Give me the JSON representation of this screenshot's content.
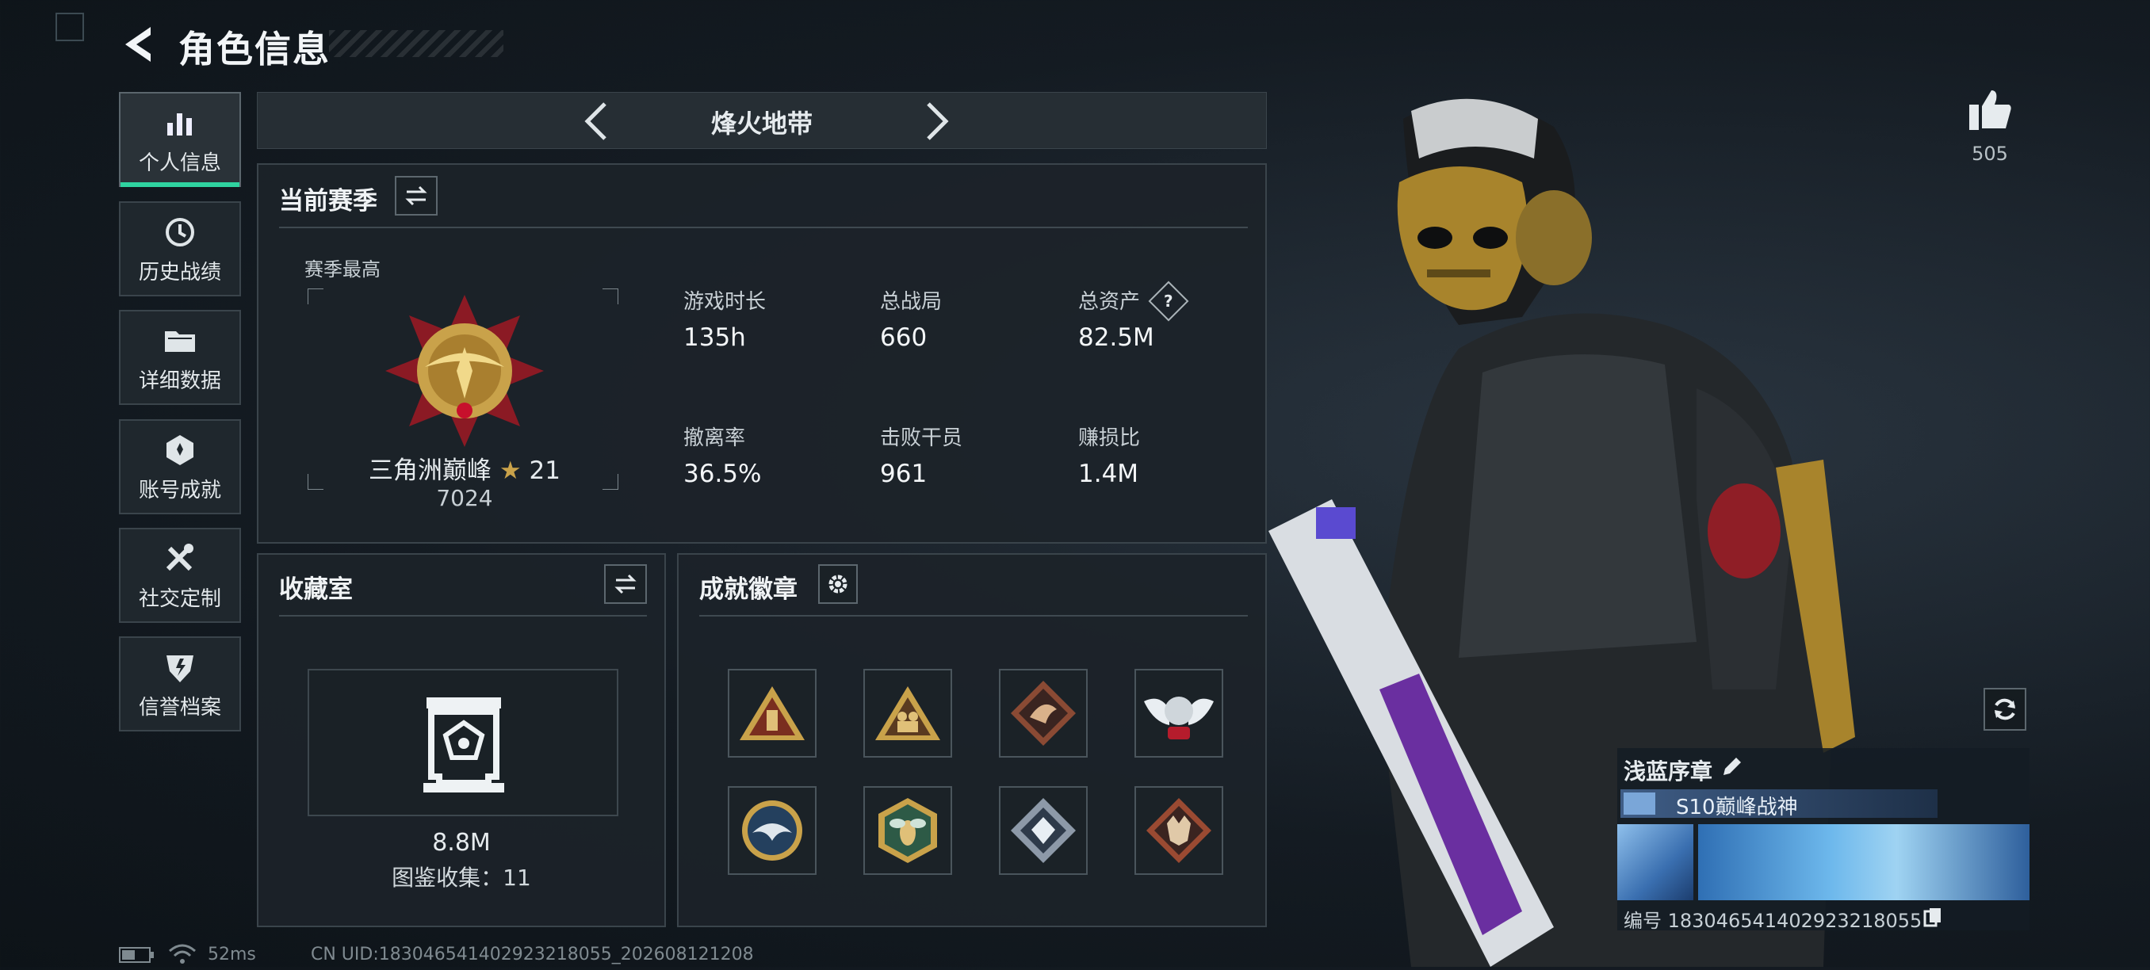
{
  "header": {
    "title": "角色信息"
  },
  "tabs": [
    {
      "label": "个人信息",
      "icon": "bar-chart-icon",
      "active": true
    },
    {
      "label": "历史战绩",
      "icon": "history-clock-icon",
      "active": false
    },
    {
      "label": "详细数据",
      "icon": "folder-icon",
      "active": false
    },
    {
      "label": "账号成就",
      "icon": "achievement-medal-icon",
      "active": false
    },
    {
      "label": "社交定制",
      "icon": "tools-icon",
      "active": false
    },
    {
      "label": "信誉档案",
      "icon": "credit-shield-icon",
      "active": false
    }
  ],
  "mode": {
    "name": "烽火地带"
  },
  "season": {
    "title": "当前赛季",
    "best_label": "赛季最高",
    "rank_name": "三角洲巅峰",
    "rank_stars": "21",
    "rank_points": "7024",
    "stats": [
      {
        "label": "游戏时长",
        "value": "135h"
      },
      {
        "label": "总战局",
        "value": "660"
      },
      {
        "label": "总资产",
        "value": "82.5M",
        "help": "?"
      },
      {
        "label": "撤离率",
        "value": "36.5%"
      },
      {
        "label": "击败干员",
        "value": "961"
      },
      {
        "label": "赚损比",
        "value": "1.4M"
      }
    ]
  },
  "collection": {
    "title": "收藏室",
    "value": "8.8M",
    "catalog_text": "图鉴收集：11"
  },
  "achievements": {
    "title": "成就徽章",
    "badges": [
      "triangle-tower-badge-icon",
      "triangle-soldiers-badge-icon",
      "dragon-diamond-badge-icon",
      "winged-helmet-badge-icon",
      "eagle-circle-badge-icon",
      "bee-hexagon-badge-icon",
      "gem-diamond-badge-icon",
      "wolf-diamond-badge-icon"
    ]
  },
  "likes": {
    "count": "505"
  },
  "card": {
    "title": "浅蓝序章",
    "subtitle": "S10巅峰战神",
    "id_text": "编号 183046541402923218055"
  },
  "footer": {
    "ping": "52ms",
    "uid": "CN UID:183046541402923218055_202608121208"
  },
  "colors": {
    "accent": "#2fd3a0",
    "gold": "#c9a24a",
    "panel": "#1c2329"
  }
}
